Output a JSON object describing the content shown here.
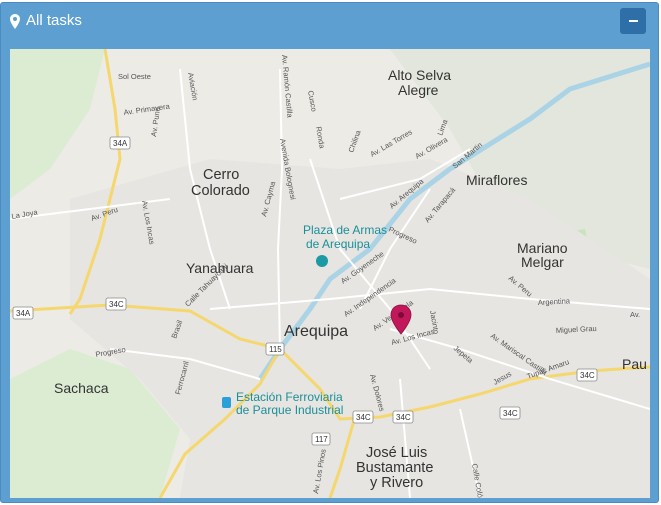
{
  "panel": {
    "title": "All tasks",
    "collapse_symbol": "−"
  },
  "map": {
    "places": {
      "alto_selva_alegre_1": "Alto Selva",
      "alto_selva_alegre_2": "Alegre",
      "cerro_colorado_1": "Cerro",
      "cerro_colorado_2": "Colorado",
      "miraflores": "Miraflores",
      "mariano_melgar_1": "Mariano",
      "mariano_melgar_2": "Melgar",
      "yanahuara": "Yanahuara",
      "arequipa": "Arequipa",
      "sachaca": "Sachaca",
      "jose_luis_1": "José Luis",
      "jose_luis_2": "Bustamante",
      "jose_luis_3": "y Rivero",
      "paucarpata_partial": "Pau",
      "plaza_1": "Plaza de Armas",
      "plaza_2": "de Arequipa",
      "estacion_1": "Estación Ferroviaria",
      "estacion_2": "de Parque Industrial"
    },
    "streets": {
      "sol_oeste": "Sol Oeste",
      "aviacion": "Aviación",
      "ramon_castilla": "Av. Ramón Castilla",
      "cusco": "Cusco",
      "av_primavera": "Av. Primavera",
      "av_puno": "Av. Puno",
      "avenida_bolognesi": "Avenida Bolognesi",
      "ronda": "Ronda",
      "chilina": "Chilina",
      "av_los_torres": "Av. Las Torres",
      "lima": "Lima",
      "av_olivera": "Av. Olivera",
      "san_martin": "San Martin",
      "la_joya": "La Joya",
      "av_peru": "Av. Peru",
      "av_los_incas_w": "Av. Los Incas",
      "av_cayma": "Av. Cayma",
      "av_arequipa": "Av. Arequipa",
      "av_tarapaca": "Av. Tarapacá",
      "progreso": "Progreso",
      "av_goyeneche": "Av. Goyeneche",
      "av_peru_e": "Av. Peru",
      "calle_tahuaycani": "Calle Tahuaycani",
      "av_independencia": "Av. Independencia",
      "argentina": "Argentina",
      "brasil": "Brasil",
      "av_venezuela": "Av. Venezuela",
      "jacinto": "Jacinto",
      "miguel_grau": "Miguel Grau",
      "av_los_incas": "Av. Los Incas",
      "av_mariscal_castilla": "Av. Mariscal Castilla",
      "progreso_s": "Progreso",
      "ferrocarril": "Ferrocarril",
      "av_dolores": "Av. Dolores",
      "jepeta": "Jepeta",
      "tupac_amaru": "Tupac Amaru",
      "jesus": "Jesus",
      "av_los_pinos": "Av. Los Pinos",
      "calle_colon": "Calle Colón",
      "av_e": "Av. "
    },
    "shields": {
      "r34a_n": "34A",
      "r34c_w": "34C",
      "r34a_w": "34A",
      "r115": "115",
      "r117": "117",
      "r34c_s": "34C",
      "r34c_s2": "34C",
      "r34c_e": "34C",
      "r34c_se": "34C"
    },
    "marker": {
      "icon": "map-marker-icon",
      "color": "#c2185b"
    }
  }
}
